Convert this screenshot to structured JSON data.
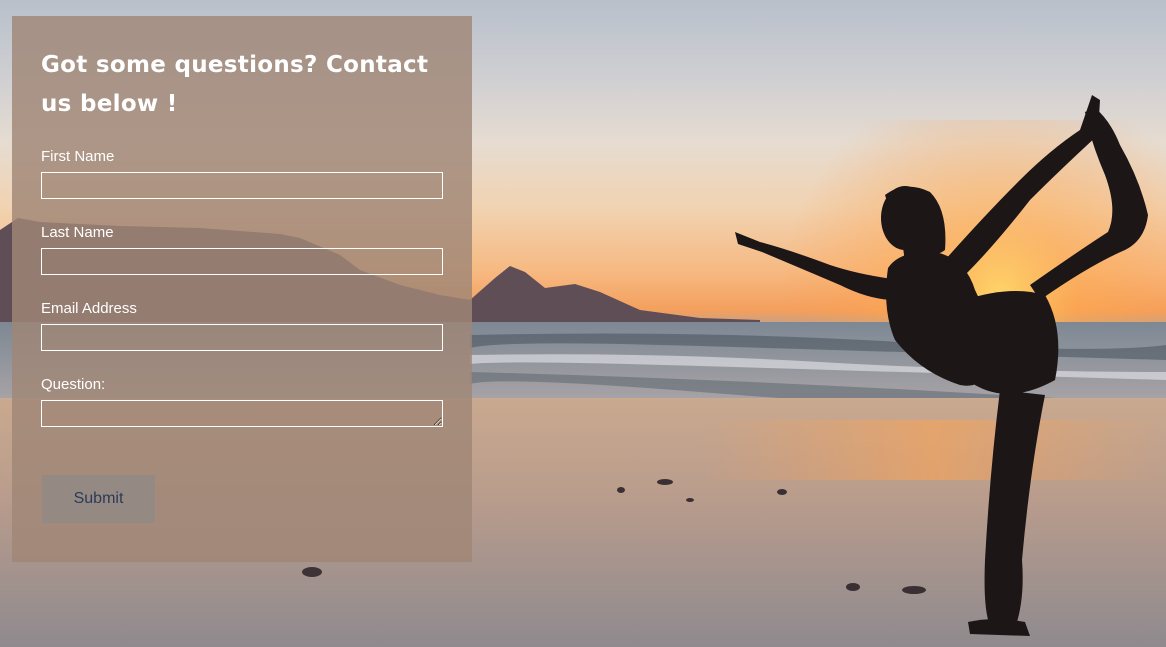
{
  "form": {
    "heading": "Got some questions? Contact us below !",
    "fields": [
      {
        "label": "First Name",
        "value": "",
        "type": "text"
      },
      {
        "label": "Last Name",
        "value": "",
        "type": "text"
      },
      {
        "label": "Email Address",
        "value": "",
        "type": "email"
      },
      {
        "label": "Question:",
        "value": "",
        "type": "textarea"
      }
    ],
    "submit_label": "Submit"
  },
  "colors": {
    "panel_overlay": "#a08676",
    "button_bg": "#958a83",
    "button_text": "#2d3a55",
    "text": "#ffffff"
  }
}
